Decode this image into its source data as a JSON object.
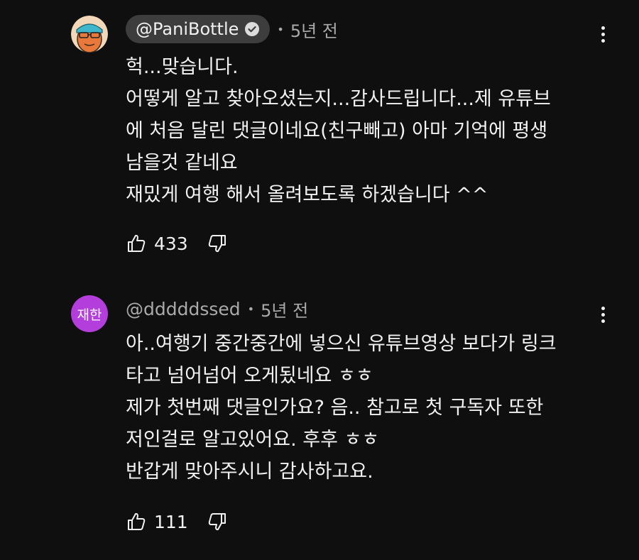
{
  "comments": [
    {
      "author": "@PaniBottle",
      "verified": true,
      "time": "5년 전",
      "lines": [
        "헉...맞습니다.",
        "어떻게 알고 찾아오셨는지...감사드립니다...제 유튜브",
        "에 처음 달린 댓글이네요(친구빼고) 아마 기억에 평생",
        "남을것 같네요",
        "재밌게 여행 해서 올려보도록 하겠습니다 ^^"
      ],
      "likes": "433"
    },
    {
      "author": "@dddddssed",
      "avatar_initials": "재한",
      "verified": false,
      "time": "5년 전",
      "lines": [
        "아..여행기 중간중간에 넣으신 유튜브영상 보다가 링크",
        "타고 넘어넘어 오게됬네요 ㅎㅎ",
        "제가 첫번째 댓글인가요? 음.. 참고로 첫 구독자 또한",
        "저인걸로 알고있어요. 후후 ㅎㅎ",
        "반갑게 맞아주시니 감사하고요."
      ],
      "likes": "111"
    }
  ],
  "separator": "•",
  "colors": {
    "background": "#0f0f0f",
    "text": "#f1f1f1",
    "secondary": "#aaaaaa",
    "chip": "#3d3d3d",
    "avatar2": "#b43edb",
    "avatar1_bg": "#e8793a"
  },
  "icons": {
    "verified": "verified-check-icon",
    "like": "thumbs-up-icon",
    "dislike": "thumbs-down-icon",
    "more": "more-vertical-icon"
  }
}
